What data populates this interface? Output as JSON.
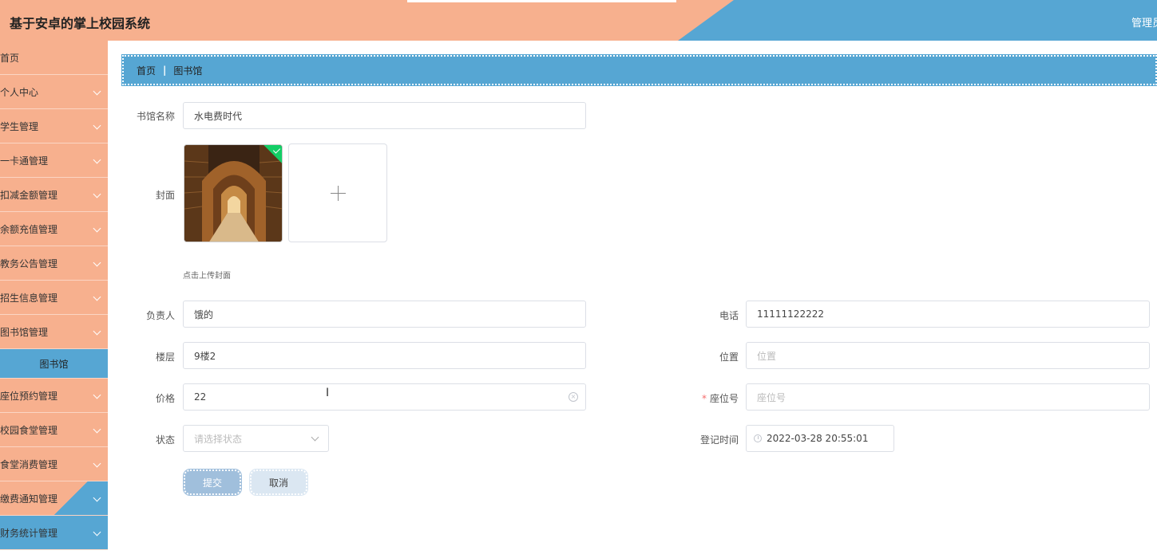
{
  "header": {
    "title": "基于安卓的掌上校园系统",
    "user_label": "管理员"
  },
  "sidebar": {
    "items": [
      {
        "label": "首页",
        "has_chevron": false
      },
      {
        "label": "个人中心",
        "has_chevron": true
      },
      {
        "label": "学生管理",
        "has_chevron": true
      },
      {
        "label": "一卡通管理",
        "has_chevron": true
      },
      {
        "label": "扣减金额管理",
        "has_chevron": true
      },
      {
        "label": "余额充值管理",
        "has_chevron": true
      },
      {
        "label": "教务公告管理",
        "has_chevron": true
      },
      {
        "label": "招生信息管理",
        "has_chevron": true
      },
      {
        "label": "图书馆管理",
        "has_chevron": true
      },
      {
        "label": "图书馆",
        "sub": true
      },
      {
        "label": "座位预约管理",
        "has_chevron": true
      },
      {
        "label": "校园食堂管理",
        "has_chevron": true
      },
      {
        "label": "食堂消费管理",
        "has_chevron": true
      },
      {
        "label": "缴费通知管理",
        "has_chevron": true
      },
      {
        "label": "财务统计管理",
        "has_chevron": true
      }
    ]
  },
  "breadcrumb": {
    "home": "首页",
    "separator": "|",
    "current": "图书馆"
  },
  "form": {
    "name_label": "书馆名称",
    "name_value": "水电费时代",
    "cover_label": "封面",
    "cover_hint": "点击上传封面",
    "manager_label": "负责人",
    "manager_value": "饿的",
    "phone_label": "电话",
    "phone_value": "11111122222",
    "floor_label": "楼层",
    "floor_value": "9楼2",
    "location_label": "位置",
    "location_placeholder": "位置",
    "price_label": "价格",
    "price_value": "22",
    "seat_label": "座位号",
    "seat_required_mark": "*",
    "seat_placeholder": "座位号",
    "status_label": "状态",
    "status_placeholder": "请选择状态",
    "time_label": "登记时间",
    "time_value": "2022-03-28 20:55:01",
    "submit_label": "提交",
    "cancel_label": "取消"
  },
  "colors": {
    "accent_orange": "#f7b08e",
    "accent_blue": "#56a6d3",
    "success_green": "#13ce66"
  }
}
